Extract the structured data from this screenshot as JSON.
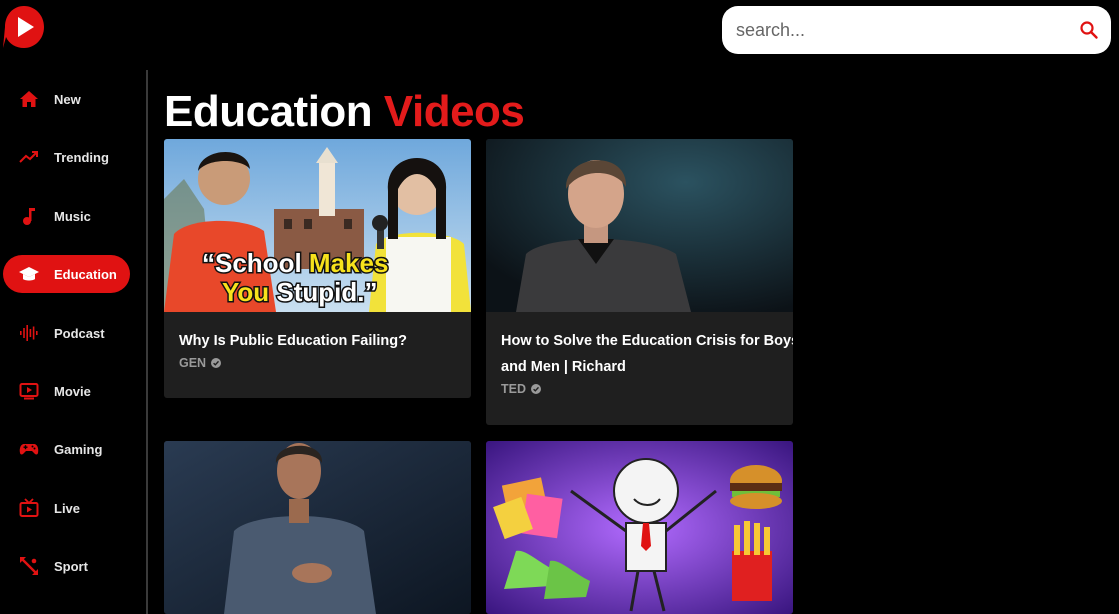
{
  "search": {
    "placeholder": "search..."
  },
  "icons": {
    "logo": "play-logo-icon",
    "search": "search-icon"
  },
  "sidebar": {
    "items": [
      {
        "label": "New",
        "icon": "home-icon",
        "active": false
      },
      {
        "label": "Trending",
        "icon": "trending-icon",
        "active": false
      },
      {
        "label": "Music",
        "icon": "music-note-icon",
        "active": false
      },
      {
        "label": "Education",
        "icon": "graduation-cap-icon",
        "active": true
      },
      {
        "label": "Podcast",
        "icon": "soundwave-icon",
        "active": false
      },
      {
        "label": "Movie",
        "icon": "movie-icon",
        "active": false
      },
      {
        "label": "Gaming",
        "icon": "gamepad-icon",
        "active": false
      },
      {
        "label": "Live",
        "icon": "live-tv-icon",
        "active": false
      },
      {
        "label": "Sport",
        "icon": "sport-icon",
        "active": false
      }
    ]
  },
  "page": {
    "title_main": "Education",
    "title_accent": "Videos"
  },
  "videos": [
    {
      "title": "Why Is Public Education Failing?",
      "channel": "GEN",
      "thumb_text_1": "“School ",
      "thumb_text_1b": "Makes",
      "thumb_text_2": "You ",
      "thumb_text_2b": "Stupid.”"
    },
    {
      "title": "How to Solve the Education Crisis for Boys and Men | Richard",
      "channel": "TED"
    },
    {
      "title": "",
      "channel": ""
    },
    {
      "title": "",
      "channel": ""
    }
  ],
  "colors": {
    "accent": "#e31b1b",
    "background": "#000000",
    "card": "#1f1f1f"
  }
}
